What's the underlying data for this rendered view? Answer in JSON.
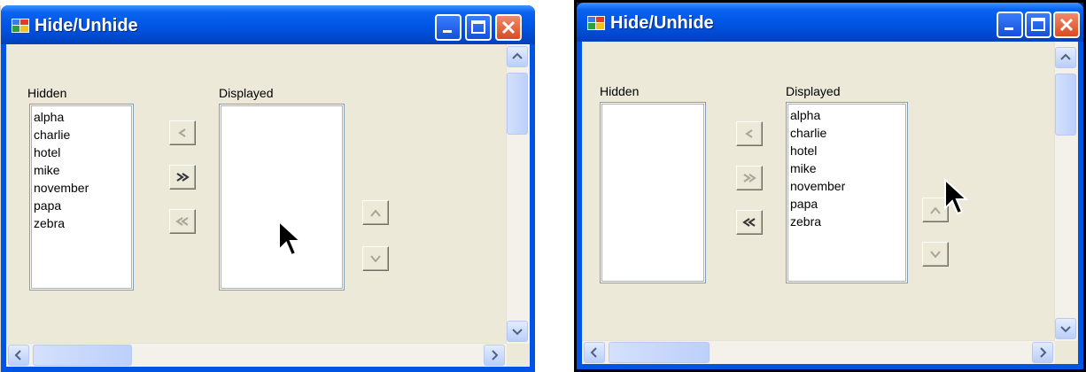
{
  "left_window": {
    "title": "Hide/Unhide",
    "hidden_label": "Hidden",
    "displayed_label": "Displayed",
    "hidden_items": [
      "alpha",
      "charlie",
      "hotel",
      "mike",
      "november",
      "papa",
      "zebra"
    ],
    "displayed_items": []
  },
  "right_window": {
    "title": "Hide/Unhide",
    "hidden_label": "Hidden",
    "displayed_label": "Displayed",
    "hidden_items": [],
    "displayed_items": [
      "alpha",
      "charlie",
      "hotel",
      "mike",
      "november",
      "papa",
      "zebra"
    ]
  },
  "icons": {
    "window_icon": "app-window-icon",
    "minimize": "minimize-icon",
    "maximize": "maximize-icon",
    "close": "close-icon",
    "move_left": "arrow-left-icon",
    "move_all_right": "double-arrow-right-icon",
    "move_all_left": "double-arrow-left-icon",
    "move_up": "arrow-up-icon",
    "move_down": "arrow-down-icon"
  },
  "colors": {
    "titlebar": "#0054e3",
    "client": "#ece9d8",
    "close_button": "#d84b22"
  }
}
